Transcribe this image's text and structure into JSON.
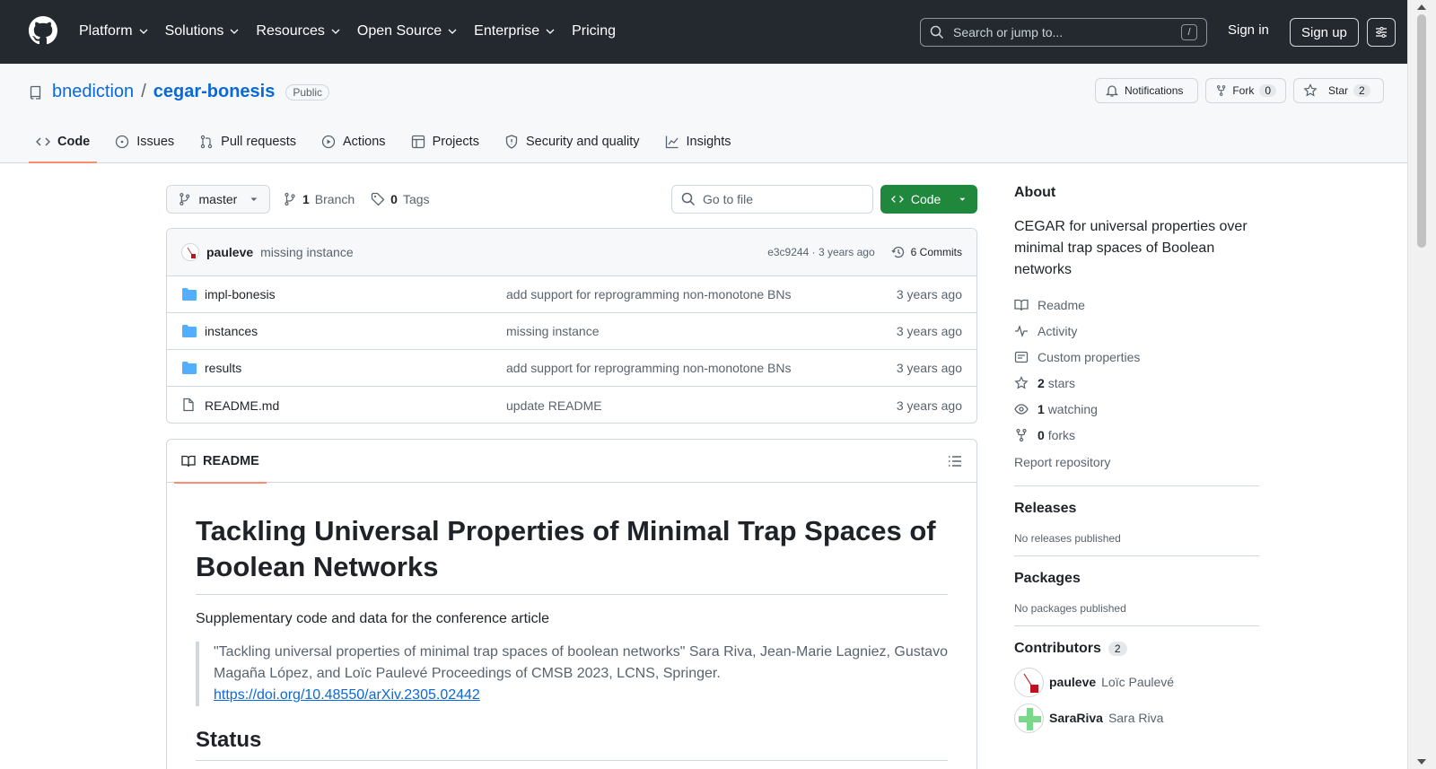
{
  "header": {
    "nav": [
      {
        "label": "Platform",
        "has_menu": true
      },
      {
        "label": "Solutions",
        "has_menu": true
      },
      {
        "label": "Resources",
        "has_menu": true
      },
      {
        "label": "Open Source",
        "has_menu": true
      },
      {
        "label": "Enterprise",
        "has_menu": true
      },
      {
        "label": "Pricing",
        "has_menu": false
      }
    ],
    "search_placeholder": "Search or jump to...",
    "search_shortcut": "/",
    "signin": "Sign in",
    "signup": "Sign up"
  },
  "repo": {
    "owner": "bnediction",
    "separator": "/",
    "name": "cegar-bonesis",
    "visibility": "Public",
    "notifications_label": "Notifications",
    "fork_label": "Fork",
    "fork_count": "0",
    "star_label": "Star",
    "star_count": "2",
    "tabs": [
      {
        "label": "Code",
        "icon": "code-icon",
        "active": true
      },
      {
        "label": "Issues",
        "icon": "issue-icon"
      },
      {
        "label": "Pull requests",
        "icon": "pull-request-icon"
      },
      {
        "label": "Actions",
        "icon": "play-icon"
      },
      {
        "label": "Projects",
        "icon": "table-icon"
      },
      {
        "label": "Security and quality",
        "icon": "shield-icon"
      },
      {
        "label": "Insights",
        "icon": "graph-icon"
      }
    ]
  },
  "toolbar": {
    "branch": "master",
    "branch_count": "1",
    "branch_label": "Branch",
    "tag_count": "0",
    "tag_label": "Tags",
    "goto_placeholder": "Go to file",
    "code_label": "Code"
  },
  "commit": {
    "author": "pauleve",
    "message": "missing instance",
    "sha": "e3c9244",
    "dot": "·",
    "age": "3 years ago",
    "commits_label": "6 Commits"
  },
  "files": [
    {
      "name": "impl-bonesis",
      "type": "folder",
      "message": "add support for reprogramming non-monotone BNs",
      "date": "3 years ago"
    },
    {
      "name": "instances",
      "type": "folder",
      "message": "missing instance",
      "date": "3 years ago"
    },
    {
      "name": "results",
      "type": "folder",
      "message": "add support for reprogramming non-monotone BNs",
      "date": "3 years ago"
    },
    {
      "name": "README.md",
      "type": "file",
      "message": "update README",
      "date": "3 years ago"
    }
  ],
  "readme": {
    "tab": "README",
    "title": "Tackling Universal Properties of Minimal Trap Spaces of Boolean Networks",
    "lead": "Supplementary code and data for the conference article",
    "quote": "\"Tackling universal properties of minimal trap spaces of boolean networks\" Sara Riva, Jean-Marie Lagniez, Gustavo Magaña López, and Loïc Paulevé Proceedings of CMSB 2023, LCNS, Springer.",
    "link": "https://doi.org/10.48550/arXiv.2305.02442",
    "h2": "Status"
  },
  "sidebar": {
    "about_title": "About",
    "description": "CEGAR for universal properties over minimal trap spaces of Boolean networks",
    "links": [
      {
        "icon": "book-icon",
        "strong": "",
        "label": "Readme"
      },
      {
        "icon": "pulse-icon",
        "strong": "",
        "label": "Activity"
      },
      {
        "icon": "note-icon",
        "strong": "",
        "label": "Custom properties"
      },
      {
        "icon": "star-icon",
        "strong": "2",
        "label": "stars"
      },
      {
        "icon": "eye-icon",
        "strong": "1",
        "label": "watching"
      },
      {
        "icon": "fork-icon",
        "strong": "0",
        "label": "forks"
      }
    ],
    "report": "Report repository",
    "releases_title": "Releases",
    "releases_empty": "No releases published",
    "packages_title": "Packages",
    "packages_empty": "No packages published",
    "contributors_title": "Contributors",
    "contributors_count": "2",
    "contributors": [
      {
        "login": "pauleve",
        "name": "Loïc Paulevé"
      },
      {
        "login": "SaraRiva",
        "name": "Sara Riva"
      }
    ]
  },
  "colors": {
    "header_bg": "#24292f",
    "link": "#0969da",
    "primary_button": "#1f883d",
    "folder": "#54aeff",
    "tab_underline": "#fd8c73"
  }
}
